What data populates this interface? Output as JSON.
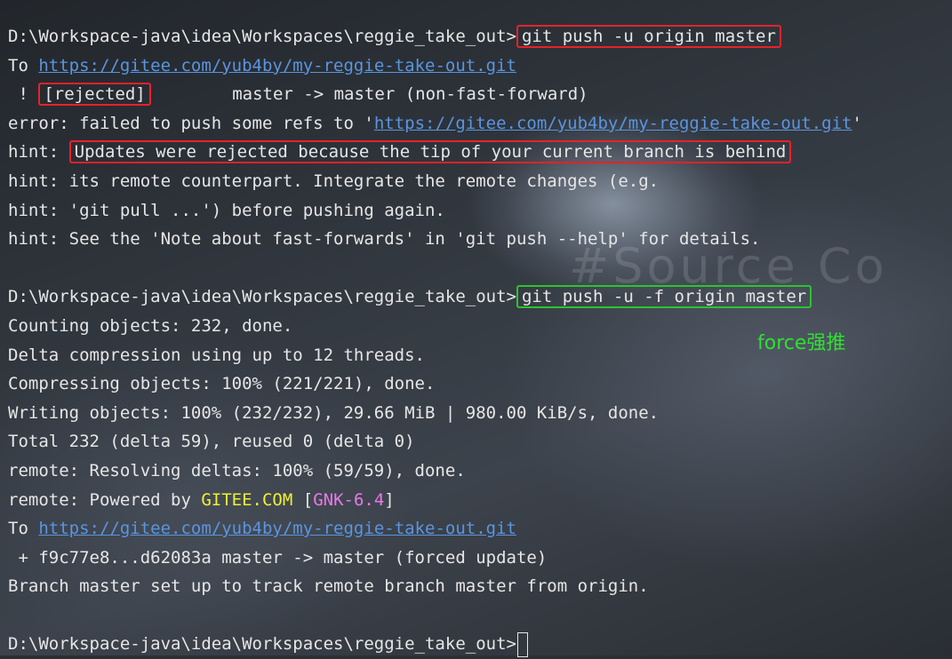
{
  "background": {
    "watermark_text": "#Source Co"
  },
  "terminal": {
    "push1": {
      "prompt": "D:\\Workspace-java\\idea\\Workspaces\\reggie_take_out>",
      "command": "git push -u origin master"
    },
    "to_prefix_1": "To ",
    "remote_url_1": "https://gitee.com/yub4by/my-reggie-take-out.git",
    "rejected_prefix": " ! ",
    "rejected_label": "[rejected]",
    "rejected_detail": "        master -> master (non-fast-forward)",
    "error_prefix": "error: failed to push some refs to '",
    "error_url": "https://gitee.com/yub4by/my-reggie-take-out.git",
    "error_suffix": "'",
    "hint1_prefix": "hint: ",
    "hint1_text": "Updates were rejected because the tip of your current branch is behind",
    "hint2": "hint: its remote counterpart. Integrate the remote changes (e.g.",
    "hint3": "hint: 'git pull ...') before pushing again.",
    "hint4": "hint: See the 'Note about fast-forwards' in 'git push --help' for details.",
    "push2": {
      "prompt": "D:\\Workspace-java\\idea\\Workspaces\\reggie_take_out>",
      "command": "git push -u -f origin master"
    },
    "counting": "Counting objects: 232, done.",
    "delta": "Delta compression using up to 12 threads.",
    "compressing": "Compressing objects: 100% (221/221), done.",
    "writing": "Writing objects: 100% (232/232), 29.66 MiB | 980.00 KiB/s, done.",
    "total": "Total 232 (delta 59), reused 0 (delta 0)",
    "resolving": "remote: Resolving deltas: 100% (59/59), done.",
    "powered_prefix": "remote: Powered by ",
    "powered_brand": "GITEE.COM",
    "powered_space": " [",
    "powered_version": "GNK-6.4",
    "powered_end": "]",
    "to_prefix_2": "To ",
    "remote_url_2": "https://gitee.com/yub4by/my-reggie-take-out.git",
    "forced_update": " + f9c77e8...d62083a master -> master (forced update)",
    "branch_tracking": "Branch master set up to track remote branch master from origin.",
    "final_prompt": "D:\\Workspace-java\\idea\\Workspaces\\reggie_take_out>"
  },
  "annotation": {
    "force_note": "force强推"
  },
  "colors": {
    "highlight_red": "#e8222a",
    "highlight_green": "#2ac52e",
    "link": "#5a95e0",
    "gitee_brand": "#f0f032",
    "version": "#e67ae6"
  }
}
